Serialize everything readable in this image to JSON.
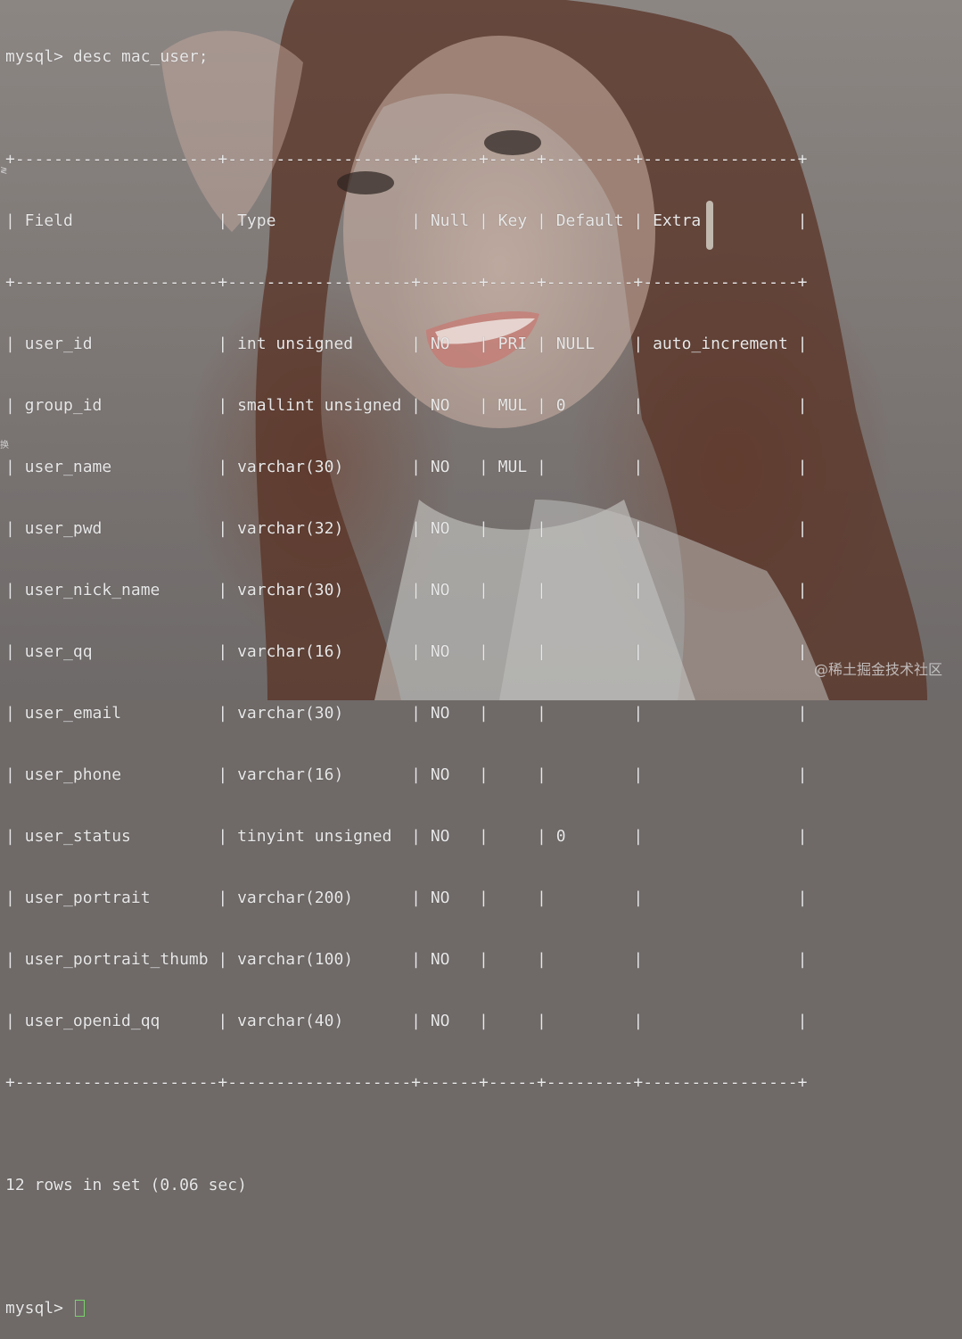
{
  "terminal": {
    "command_line": "mysql> desc mac_user;",
    "table_lines": [
      "+---------------------+-------------------+------+-----+---------+----------------+",
      "| Field               | Type              | Null | Key | Default | Extra          |",
      "+---------------------+-------------------+------+-----+---------+----------------+",
      "| user_id             | int unsigned      | NO   | PRI | NULL    | auto_increment |",
      "| group_id            | smallint unsigned | NO   | MUL | 0       |                |",
      "| user_name           | varchar(30)       | NO   | MUL |         |                |",
      "| user_pwd            | varchar(32)       | NO   |     |         |                |",
      "| user_nick_name      | varchar(30)       | NO   |     |         |                |",
      "| user_qq             | varchar(16)       | NO   |     |         |                |",
      "| user_email          | varchar(30)       | NO   |     |         |                |",
      "| user_phone          | varchar(16)       | NO   |     |         |                |",
      "| user_status         | tinyint unsigned  | NO   |     | 0       |                |",
      "| user_portrait       | varchar(200)      | NO   |     |         |                |",
      "| user_portrait_thumb | varchar(100)      | NO   |     |         |                |",
      "| user_openid_qq      | varchar(40)       | NO   |     |         |                |",
      "+---------------------+-------------------+------+-----+---------+----------------+"
    ],
    "result_summary": "12 rows in set (0.06 sec)",
    "blank": "",
    "prompt": "mysql> "
  },
  "watermark": "@稀土掘金技术社区",
  "edge_glyph_1": "≷",
  "edge_glyph_2": "换",
  "colors": {
    "text": "#e8e8e8",
    "cursor": "#79d36b"
  }
}
